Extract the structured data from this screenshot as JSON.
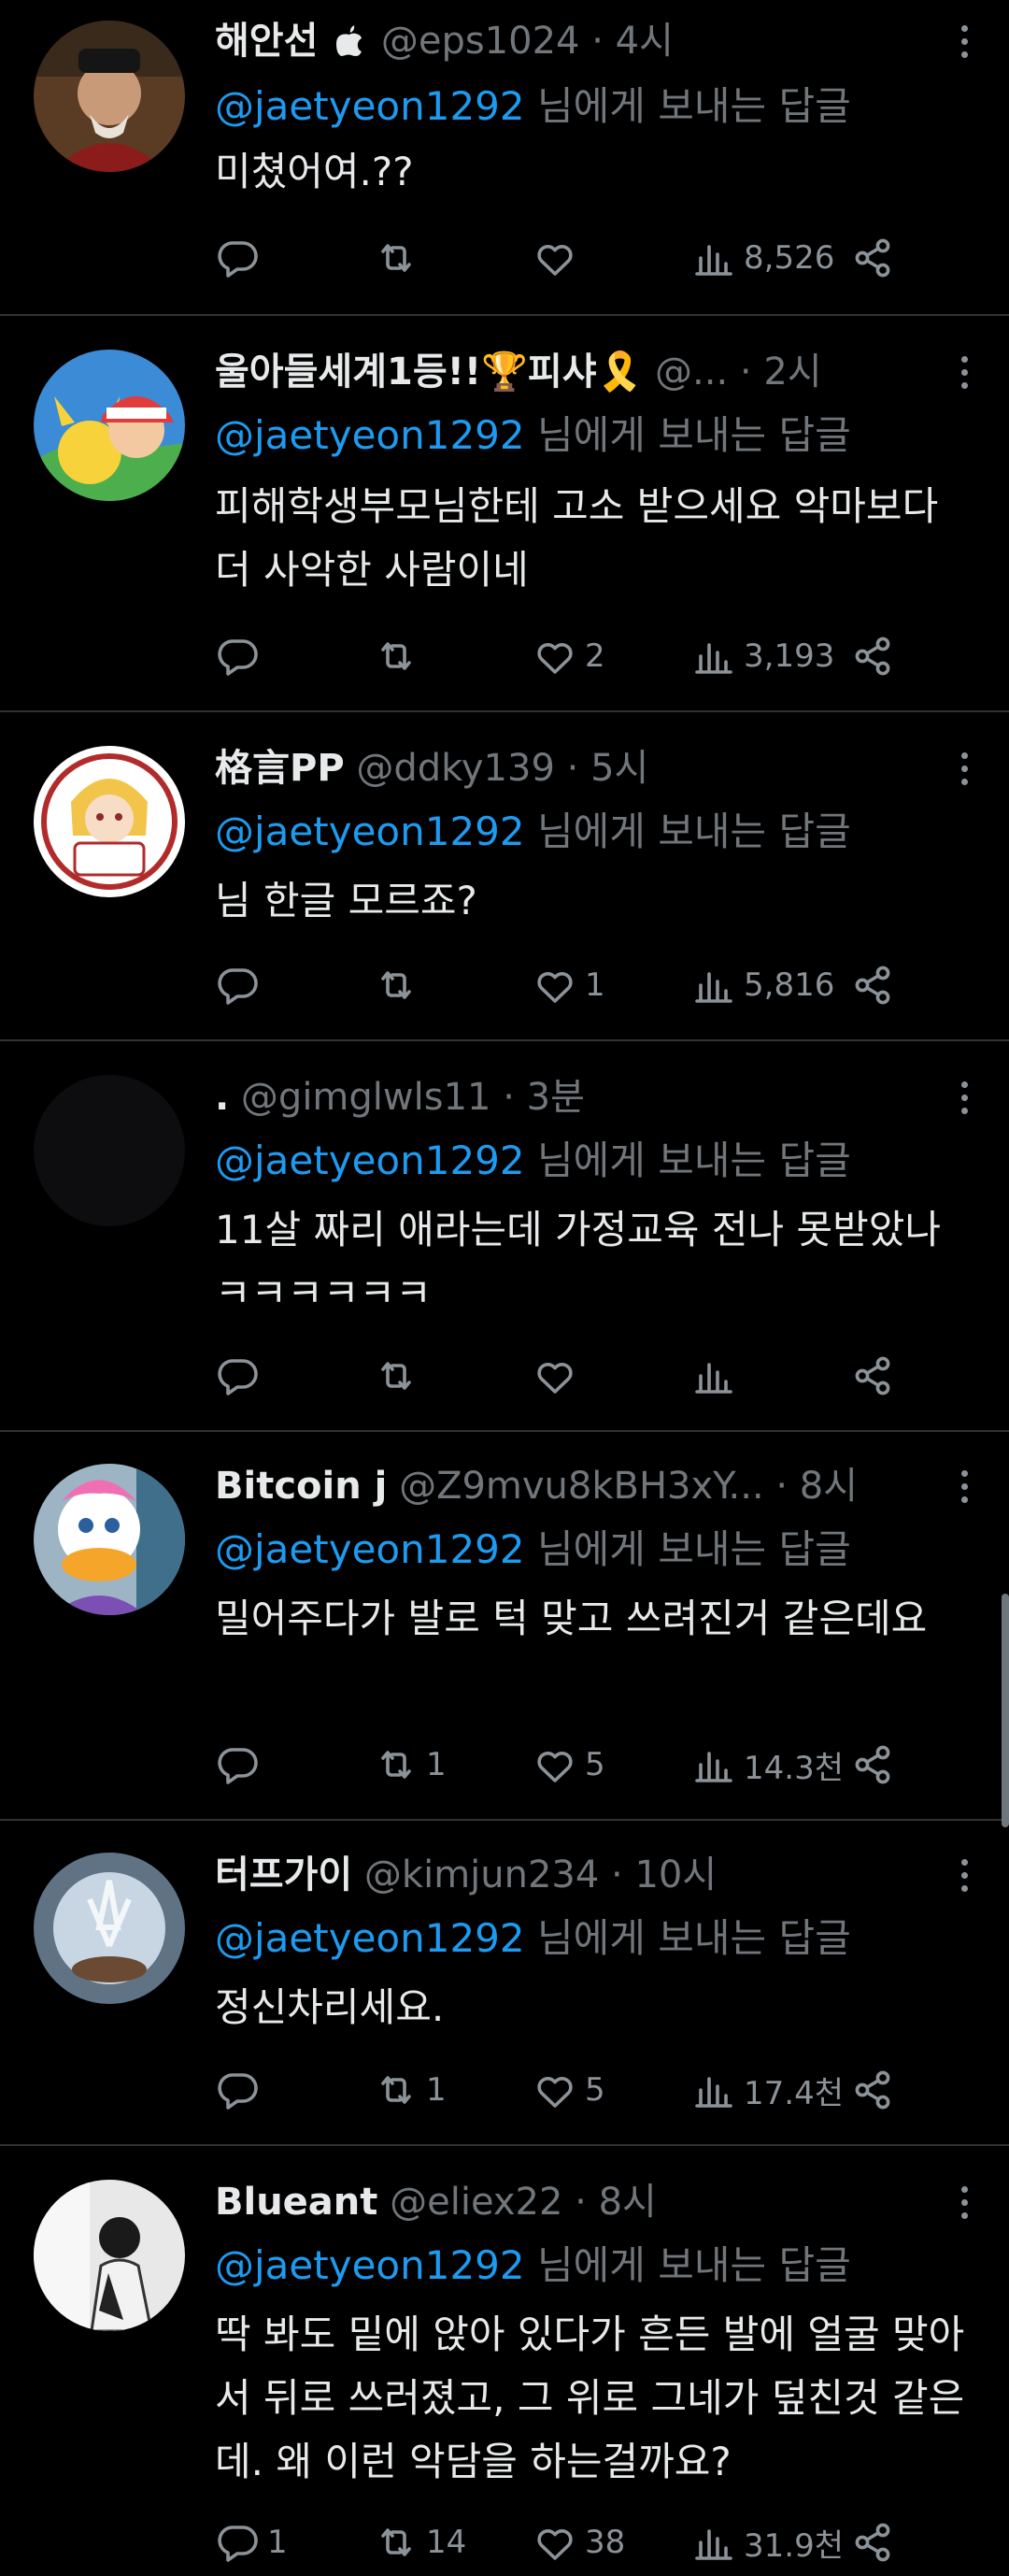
{
  "replying_to_suffix": "님에게 보내는 답글",
  "tweets": [
    {
      "name": "해안선",
      "badge": "",
      "handle": "@eps1024",
      "time": "4시",
      "mention": "@jaetyeon1292",
      "text": "미쳤어여.??",
      "replies": "",
      "retweets": "",
      "likes": "",
      "views": "8,526"
    },
    {
      "name": "울아들세계1등!!🏆피샤🎗️",
      "badge": "",
      "handle": "@...",
      "time": "2시",
      "mention": "@jaetyeon1292",
      "text": "피해학생부모님한테 고소 받으세요 악마보다 더 사악한 사람이네",
      "replies": "",
      "retweets": "",
      "likes": "2",
      "views": "3,193"
    },
    {
      "name": "格言PP",
      "badge": "",
      "handle": "@ddky139",
      "time": "5시",
      "mention": "@jaetyeon1292",
      "text": "님 한글 모르죠?",
      "replies": "",
      "retweets": "",
      "likes": "1",
      "views": "5,816"
    },
    {
      "name": ".",
      "badge": "",
      "handle": "@gimglwls11",
      "time": "3분",
      "mention": "@jaetyeon1292",
      "text": "11살 짜리 애라는데 가정교육 전나 못받았나ㅋㅋㅋㅋㅋㅋ",
      "replies": "",
      "retweets": "",
      "likes": "",
      "views": ""
    },
    {
      "name": "Bitcoin j",
      "badge": "",
      "handle": "@Z9mvu8kBH3xY...",
      "time": "8시",
      "mention": "@jaetyeon1292",
      "text": "밀어주다가 발로 턱 맞고 쓰려진거 같은데요",
      "replies": "",
      "retweets": "1",
      "likes": "5",
      "views": "14.3천"
    },
    {
      "name": "터프가이",
      "badge": "",
      "handle": "@kimjun234",
      "time": "10시",
      "mention": "@jaetyeon1292",
      "text": "정신차리세요.",
      "replies": "",
      "retweets": "1",
      "likes": "5",
      "views": "17.4천"
    },
    {
      "name": "Blueant",
      "badge": "",
      "handle": "@eliex22",
      "time": "8시",
      "mention": "@jaetyeon1292",
      "text": "딱 봐도 밑에 앉아 있다가 흔든 발에 얼굴 맞아서 뒤로 쓰러졌고, 그 위로 그네가 덮친것 같은데. 왜 이런 악담을 하는걸까요?",
      "replies": "1",
      "retweets": "14",
      "likes": "38",
      "views": "31.9천"
    }
  ],
  "colors": {
    "background": "#000000",
    "mention": "#1d9bf0",
    "muted": "#71767b",
    "text": "#e7e9ea",
    "divider": "#2f3336"
  },
  "icons": [
    "apple-icon",
    "reply-icon",
    "retweet-icon",
    "like-icon",
    "views-icon",
    "share-icon",
    "more-icon"
  ]
}
